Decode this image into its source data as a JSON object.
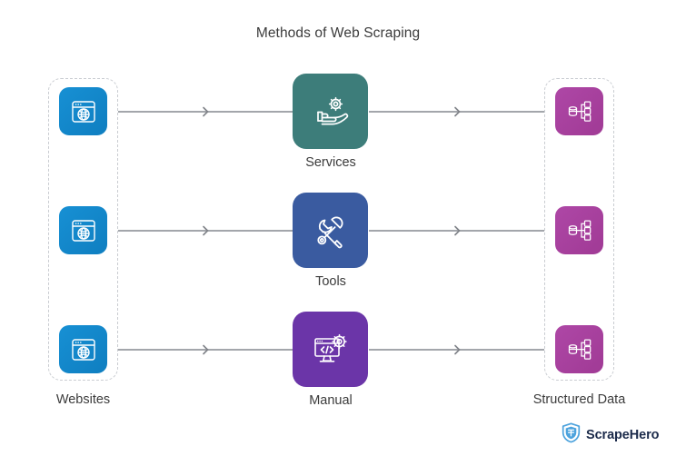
{
  "title": "Methods of Web Scraping",
  "groups": {
    "left": {
      "label": "Websites",
      "icon": "browser-globe-icon",
      "color": "#1184c8",
      "count": 3
    },
    "right": {
      "label": "Structured Data",
      "icon": "database-tree-icon",
      "color": "#a83f9c",
      "count": 3
    }
  },
  "methods": [
    {
      "label": "Services",
      "icon": "hand-gear-icon",
      "color": "#3d7d7a"
    },
    {
      "label": "Tools",
      "icon": "screwdriver-wrench-icon",
      "color": "#3a5ba0"
    },
    {
      "label": "Manual",
      "icon": "monitor-code-gear-icon",
      "color": "#6b35a8"
    }
  ],
  "connectors": {
    "marker": "chevron-right-icon",
    "color": "#a3a6ab",
    "rows": [
      {
        "from": "Websites",
        "to": "Services",
        "then": "Structured Data"
      },
      {
        "from": "Websites",
        "to": "Tools",
        "then": "Structured Data"
      },
      {
        "from": "Websites",
        "to": "Manual",
        "then": "Structured Data"
      }
    ]
  },
  "brand": {
    "name": "ScrapeHero",
    "icon": "scrapehero-shield-logo",
    "shield_color": "#4da3dd",
    "text_color": "#1b2a4a"
  }
}
